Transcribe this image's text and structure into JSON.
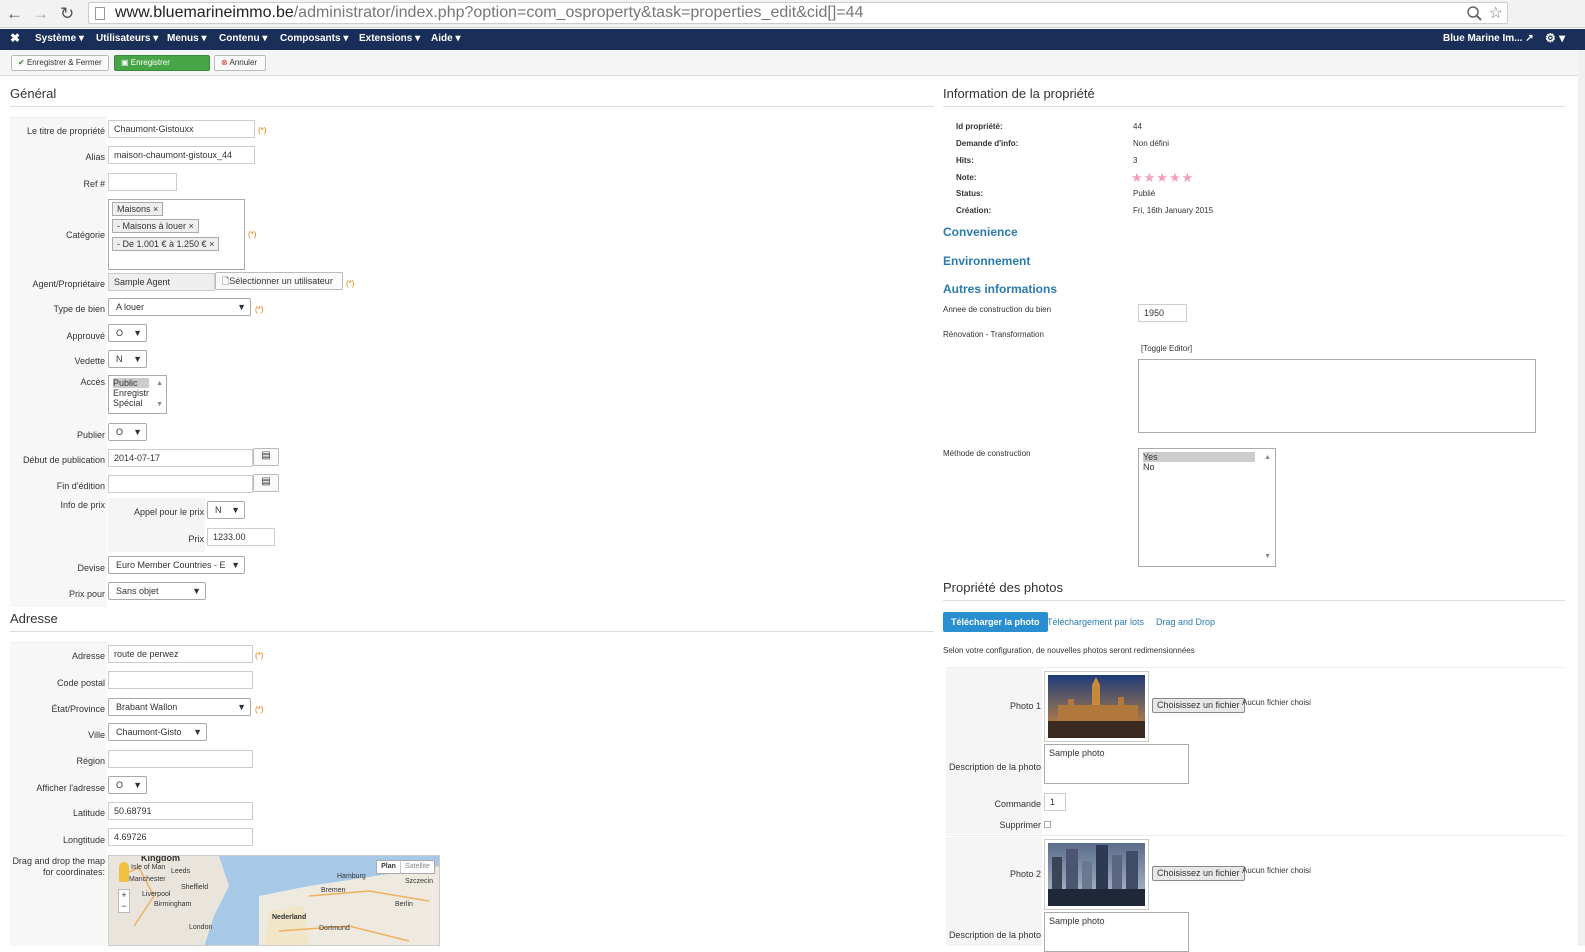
{
  "browser": {
    "url_host": "www.bluemarineimmo.be",
    "url_path": "/administrator/index.php?option=com_osproperty&task=properties_edit&cid[]=44"
  },
  "topmenu": {
    "items": [
      "Système",
      "Utilisateurs",
      "Menus",
      "Contenu",
      "Composants",
      "Extensions",
      "Aide"
    ],
    "site_name": "Blue Marine Im..."
  },
  "toolbar": {
    "save_close": "Enregistrer & Fermer",
    "save": "Enregistrer",
    "cancel": "Annuler"
  },
  "general": {
    "heading": "Général",
    "title_label": "Le titre de propriété",
    "title_value": "Chaumont-Gistouxx",
    "alias_label": "Alias",
    "alias_value": "maison-chaumont-gistoux_44",
    "ref_label": "Ref #",
    "ref_value": "",
    "category_label": "Catégorie",
    "categories": [
      "Maisons",
      "- Maisons à louer",
      "- De 1.001 € à 1.250 €"
    ],
    "agent_label": "Agent/Propriétaire",
    "agent_value": "Sample Agent",
    "select_user": "Sélectionner un utilisateur",
    "type_label": "Type de bien",
    "type_value": "A louer",
    "approved_label": "Approuvé",
    "approved_value": "O",
    "featured_label": "Vedette",
    "featured_value": "N",
    "access_label": "Accès",
    "access_options": [
      "Public",
      "Enregistré",
      "Spécial"
    ],
    "publish_label": "Publier",
    "publish_value": "O",
    "pub_start_label": "Début de publication",
    "pub_start_value": "2014-07-17",
    "pub_end_label": "Fin d'édition",
    "pub_end_value": "",
    "price_info_label": "Info de prix",
    "call_price_label": "Appel pour le prix",
    "call_price_value": "N",
    "price_label": "Prix",
    "price_value": "1233.00",
    "currency_label": "Devise",
    "currency_value": "Euro Member Countries - E",
    "price_for_label": "Prix pour",
    "price_for_value": "Sans objet",
    "required_mark": "(*)"
  },
  "address": {
    "heading": "Adresse",
    "address_label": "Adresse",
    "address_value": "route de perwez",
    "postal_label": "Code postal",
    "postal_value": "",
    "state_label": "État/Province",
    "state_value": "Brabant Wallon",
    "city_label": "Ville",
    "city_value": "Chaumont-Gistoux",
    "region_label": "Région",
    "region_value": "",
    "show_address_label": "Afficher l'adresse",
    "show_address_value": "O",
    "lat_label": "Latitude",
    "lat_value": "50.68791",
    "lng_label": "Longtitude",
    "lng_value": "4.69726",
    "map_label": "Drag and drop the map for coordinates:",
    "map_plan": "Plan",
    "map_satellite": "Satellite",
    "map_cities": [
      "Kingdom",
      "Isle of Man",
      "Leeds",
      "Manchester",
      "Sheffield",
      "Liverpool",
      "Birmingham",
      "Hamburg",
      "Bremen",
      "Szczecin",
      "Berlin",
      "Nederland",
      "Dortmund",
      "London"
    ]
  },
  "info": {
    "heading": "Information de la propriété",
    "rows": [
      {
        "label": "Id propriété:",
        "value": "44"
      },
      {
        "label": "Demande d'info:",
        "value": "Non défini"
      },
      {
        "label": "Hits:",
        "value": "3"
      },
      {
        "label": "Note:",
        "value": "★★★★★"
      },
      {
        "label": "Status:",
        "value": "Publié"
      },
      {
        "label": "Création:",
        "value": "Fri, 16th January 2015"
      }
    ],
    "convenience": "Convenience",
    "environment": "Environnement",
    "other_info": "Autres informations",
    "year_label": "Annee de construction du bien",
    "year_value": "1950",
    "renovation_label": "Rénovation - Transformation",
    "toggle_editor": "[Toggle Editor]",
    "method_label": "Méthode de construction",
    "method_options": [
      "Yes",
      "No"
    ]
  },
  "photos": {
    "heading": "Propriété des photos",
    "tabs": [
      "Télécharger la photo",
      "Téléchargement par lots",
      "Drag and Drop"
    ],
    "note": "Selon votre configuration, de nouvelles photos seront redimensionnées",
    "photo1_label": "Photo 1",
    "photo2_label": "Photo 2",
    "choose_file": "Choisissez un fichier",
    "no_file": "Aucun fichier choisi",
    "desc_label": "Description de la photo",
    "desc_value": "Sample photo",
    "order_label": "Commande",
    "order_value": "1",
    "delete_label": "Supprimer"
  }
}
